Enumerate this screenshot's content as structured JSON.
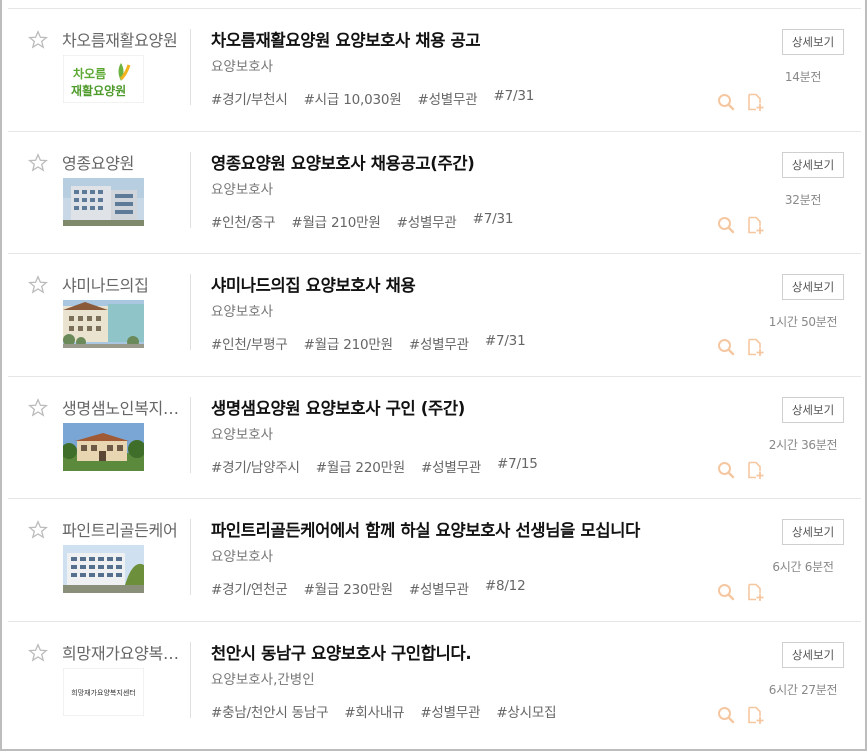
{
  "button_label": "상세보기",
  "colors": {
    "action_icon": "#f5c7a1",
    "star": "#bbbbbb",
    "title": "#111111",
    "tag": "#666666"
  },
  "listings": [
    {
      "company": "차오름재활요양원",
      "title": "차오름재활요양원 요양보호사 채용 공고",
      "job": "요양보호사",
      "tags": [
        "#경기/부천시",
        "#시급 10,030원",
        "#성별무관",
        "#7/31"
      ],
      "posted": "14분전",
      "logo_text": [
        "차오름",
        "재활요양원"
      ]
    },
    {
      "company": "영종요양원",
      "title": "영종요양원 요양보호사 채용공고(주간)",
      "job": "요양보호사",
      "tags": [
        "#인천/중구",
        "#월급 210만원",
        "#성별무관",
        "#7/31"
      ],
      "posted": "32분전"
    },
    {
      "company": "샤미나드의집",
      "title": "샤미나드의집 요양보호사 채용",
      "job": "요양보호사",
      "tags": [
        "#인천/부평구",
        "#월급 210만원",
        "#성별무관",
        "#7/31"
      ],
      "posted": "1시간 50분전"
    },
    {
      "company": "생명샘노인복지센터",
      "title": "생명샘요양원 요양보호사 구인 (주간)",
      "job": "요양보호사",
      "tags": [
        "#경기/남양주시",
        "#월급 220만원",
        "#성별무관",
        "#7/15"
      ],
      "posted": "2시간 36분전"
    },
    {
      "company": "파인트리골든케어",
      "title": "파인트리골든케어에서 함께 하실 요양보호사 선생님을 모십니다",
      "job": "요양보호사",
      "tags": [
        "#경기/연천군",
        "#월급 230만원",
        "#성별무관",
        "#8/12"
      ],
      "posted": "6시간 6분전"
    },
    {
      "company": "희망재가요양복지센터",
      "title": "천안시 동남구 요양보호사 구인합니다.",
      "job": "요양보호사,간병인",
      "tags": [
        "#충남/천안시 동남구",
        "#회사내규",
        "#성별무관",
        "#상시모집"
      ],
      "posted": "6시간 27분전",
      "logo_text": [
        "희망재가요양복지센터"
      ]
    }
  ]
}
